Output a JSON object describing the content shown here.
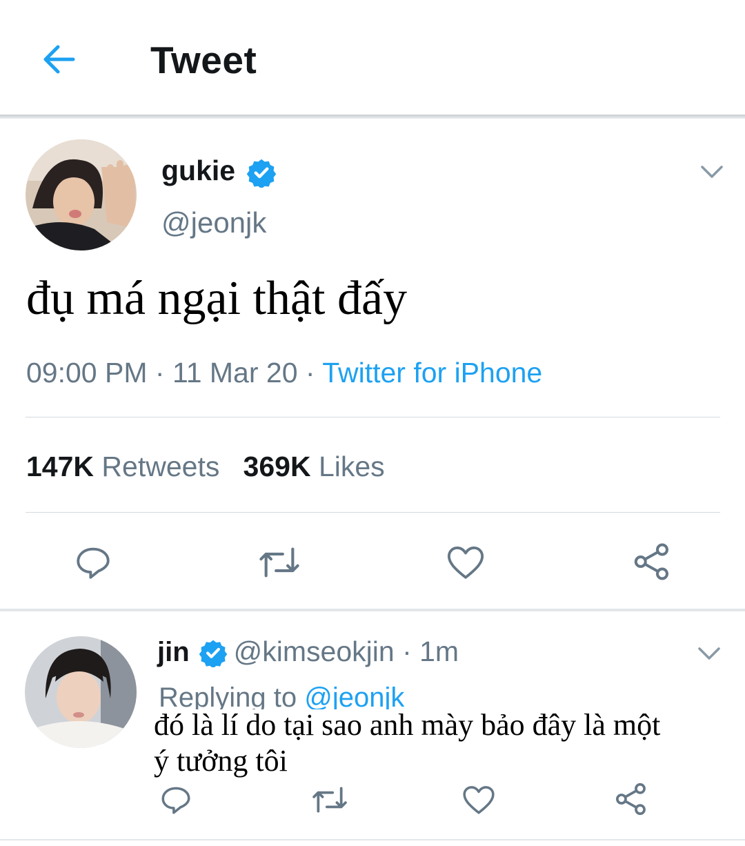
{
  "header": {
    "title": "Tweet"
  },
  "tweet": {
    "display_name": "gukie",
    "handle": "@jeonjk",
    "text": "đụ má ngại thật đấy",
    "time": "09:00 PM",
    "separator": " · ",
    "date": "11 Mar 20",
    "source": "Twitter for iPhone",
    "retweets_count": "147K",
    "retweets_label": "Retweets",
    "likes_count": "369K",
    "likes_label": "Likes"
  },
  "reply": {
    "display_name": "jin",
    "handle": "@kimseokjin",
    "separator": " · ",
    "time": "1m",
    "replying_to_label": "Replying to ",
    "replying_to_handle": "@jeonjk",
    "text": "đó là lí do tại sao anh mày bảo đây là một ý tưởng tôi"
  },
  "colors": {
    "accent": "#1da1f2",
    "secondary_text": "#657786",
    "primary_text": "#14171a",
    "divider": "#e1e8ed"
  },
  "icons": [
    "back-arrow-icon",
    "verified-badge-icon",
    "chevron-down-icon",
    "reply-icon",
    "retweet-icon",
    "like-icon",
    "share-icon"
  ]
}
